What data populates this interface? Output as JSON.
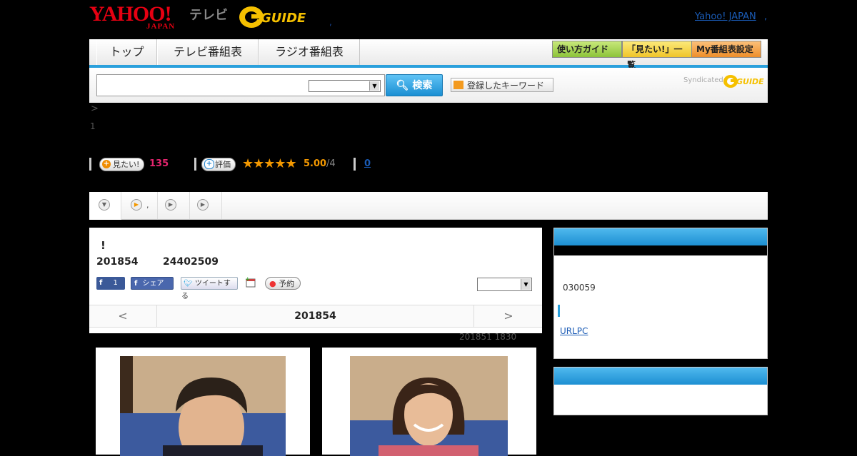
{
  "header": {
    "yahoo_logo": "YAHOO!",
    "yahoo_logo_sub": "JAPAN",
    "tv_label": "テレビ",
    "gguide_logo": "GUIDE",
    "dot_left": ",",
    "yahoo_japan_link": "Yahoo! JAPAN",
    "dot_right": ","
  },
  "nav": {
    "tabs": [
      {
        "label": "トップ"
      },
      {
        "label": "テレビ番組表"
      },
      {
        "label": "ラジオ番組表"
      }
    ],
    "right_buttons": [
      {
        "label": "使い方ガイド",
        "color": "#9ccc3c"
      },
      {
        "label": "「見たい!」一覧",
        "color": "#f5d23a"
      },
      {
        "label": "My番組表設定",
        "color": "#f29a3a"
      }
    ]
  },
  "search": {
    "input_value": "",
    "select_value": "",
    "search_button": "検索",
    "keyword_button": "登録したキーワード",
    "syndicated_label": "Syndicated",
    "syndicated_logo": "GUIDE"
  },
  "breadcrumb_arrow": ">",
  "page_number": "1",
  "stats": {
    "want_label": "見たい!",
    "want_count": "135",
    "rate_label": "評価",
    "rating": 5.0,
    "rating_text": "5.00",
    "rating_count": "/4",
    "comment_count": "0"
  },
  "tabs_band": {
    "tab2_label": ",",
    "tab3_label": "",
    "tab4_label": ""
  },
  "program": {
    "title": "!",
    "date": "201854",
    "id": "24402509",
    "fb_count": "1",
    "fb_share": "シェア",
    "tweet": "ツイートする",
    "reserve": "予約",
    "select_value": "",
    "pager_prev": "<",
    "pager_date": "201854",
    "pager_next": ">"
  },
  "timestamp": "201851  1830",
  "right_panel": {
    "number": "030059",
    "url_link": "URLPC"
  },
  "colors": {
    "accent_blue": "#2aa0dc",
    "want_count": "#e6256f",
    "rating": "#f39800"
  }
}
